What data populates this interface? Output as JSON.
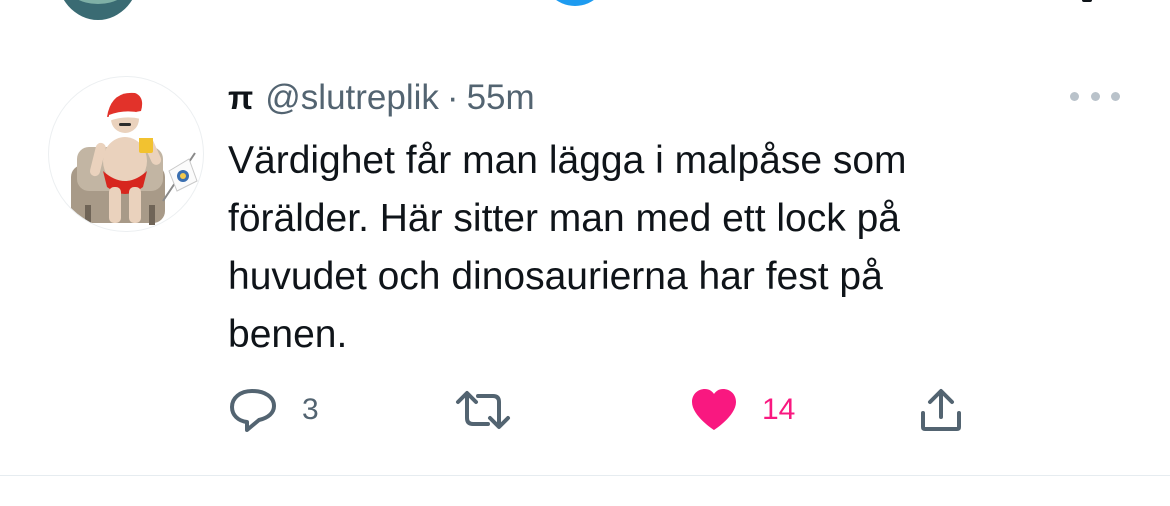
{
  "tweet": {
    "display_name": "π",
    "handle": "@slutreplik",
    "separator": "·",
    "timestamp": "55m",
    "text": "Värdighet får man lägga i malpåse som\nförälder. Här sitter man med ett lock på\nhuvudet och dinosaurierna har fest på\nbenen.",
    "avatar_icon": "man-in-santa-hat-on-armchair-avatar",
    "more_icon": "more-dots-icon"
  },
  "actions": {
    "reply": {
      "icon": "reply-bubble-icon",
      "count": "3"
    },
    "retweet": {
      "icon": "retweet-icon",
      "count": ""
    },
    "like": {
      "icon": "heart-filled-icon",
      "count": "14",
      "color": "#f91880"
    },
    "share": {
      "icon": "share-upload-icon"
    }
  },
  "colors": {
    "text": "#0f1419",
    "secondary": "#536471",
    "like": "#f91880",
    "divider": "#e6ecf0"
  }
}
